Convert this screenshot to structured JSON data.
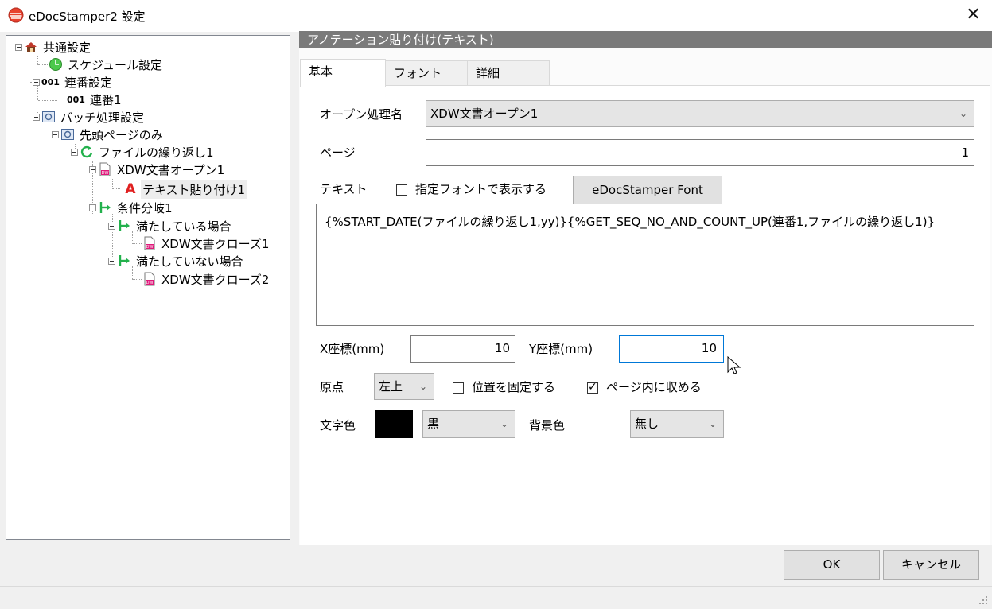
{
  "window": {
    "title": "eDocStamper2 設定",
    "close_glyph": "✕"
  },
  "tree": {
    "items": [
      {
        "label": "共通設定",
        "icon": "house-icon"
      },
      {
        "label": "スケジュール設定",
        "icon": "clock-icon"
      },
      {
        "label": "連番設定",
        "icon": "seq-001-icon",
        "icon_text": "001"
      },
      {
        "label": "連番1",
        "icon": "seq-001-icon",
        "icon_text": "001"
      },
      {
        "label": "バッチ処理設定",
        "icon": "gear-doc-icon"
      },
      {
        "label": "先頭ページのみ",
        "icon": "gear-doc-icon"
      },
      {
        "label": "ファイルの繰り返し1",
        "icon": "loop-icon"
      },
      {
        "label": "XDW文書オープン1",
        "icon": "xdw-doc-icon",
        "icon_text": "DW"
      },
      {
        "label": "テキスト貼り付け1",
        "icon": "text-a-icon",
        "icon_text": "A",
        "selected": true
      },
      {
        "label": "条件分岐1",
        "icon": "branch-icon"
      },
      {
        "label": "満たしている場合",
        "icon": "branch-icon"
      },
      {
        "label": "XDW文書クローズ1",
        "icon": "xdw-doc-icon",
        "icon_text": "DW"
      },
      {
        "label": "満たしていない場合",
        "icon": "branch-icon"
      },
      {
        "label": "XDW文書クローズ2",
        "icon": "xdw-doc-icon",
        "icon_text": "DW"
      }
    ]
  },
  "pane": {
    "header": "アノテーション貼り付け(テキスト)",
    "tabs": [
      {
        "label": "基本",
        "active": true
      },
      {
        "label": "フォント",
        "active": false
      },
      {
        "label": "詳細",
        "active": false
      }
    ]
  },
  "form": {
    "open_name_label": "オープン処理名",
    "open_name_value": "XDW文書オープン1",
    "page_label": "ページ",
    "page_value": "1",
    "text_label": "テキスト",
    "font_checkbox_label": "指定フォントで表示する",
    "font_checkbox_checked": false,
    "font_button": "eDocStamper Font",
    "text_value": "{%START_DATE(ファイルの繰り返し1,yy)}{%GET_SEQ_NO_AND_COUNT_UP(連番1,ファイルの繰り返し1)}",
    "x_label": "X座標(mm)",
    "x_value": "10",
    "y_label": "Y座標(mm)",
    "y_value": "10",
    "origin_label": "原点",
    "origin_value": "左上",
    "fix_pos_label": "位置を固定する",
    "fix_pos_checked": false,
    "fit_page_label": "ページ内に収める",
    "fit_page_checked": true,
    "text_color_label": "文字色",
    "text_color_swatch": "#000000",
    "text_color_value": "黒",
    "bg_color_label": "背景色",
    "bg_color_value": "無し"
  },
  "footer": {
    "ok": "OK",
    "cancel": "キャンセル"
  },
  "colors": {
    "accent": "#0078d7",
    "header_bg": "#7a7a7a",
    "branch_green": "#22b14c",
    "text_icon_red": "#e02020"
  }
}
